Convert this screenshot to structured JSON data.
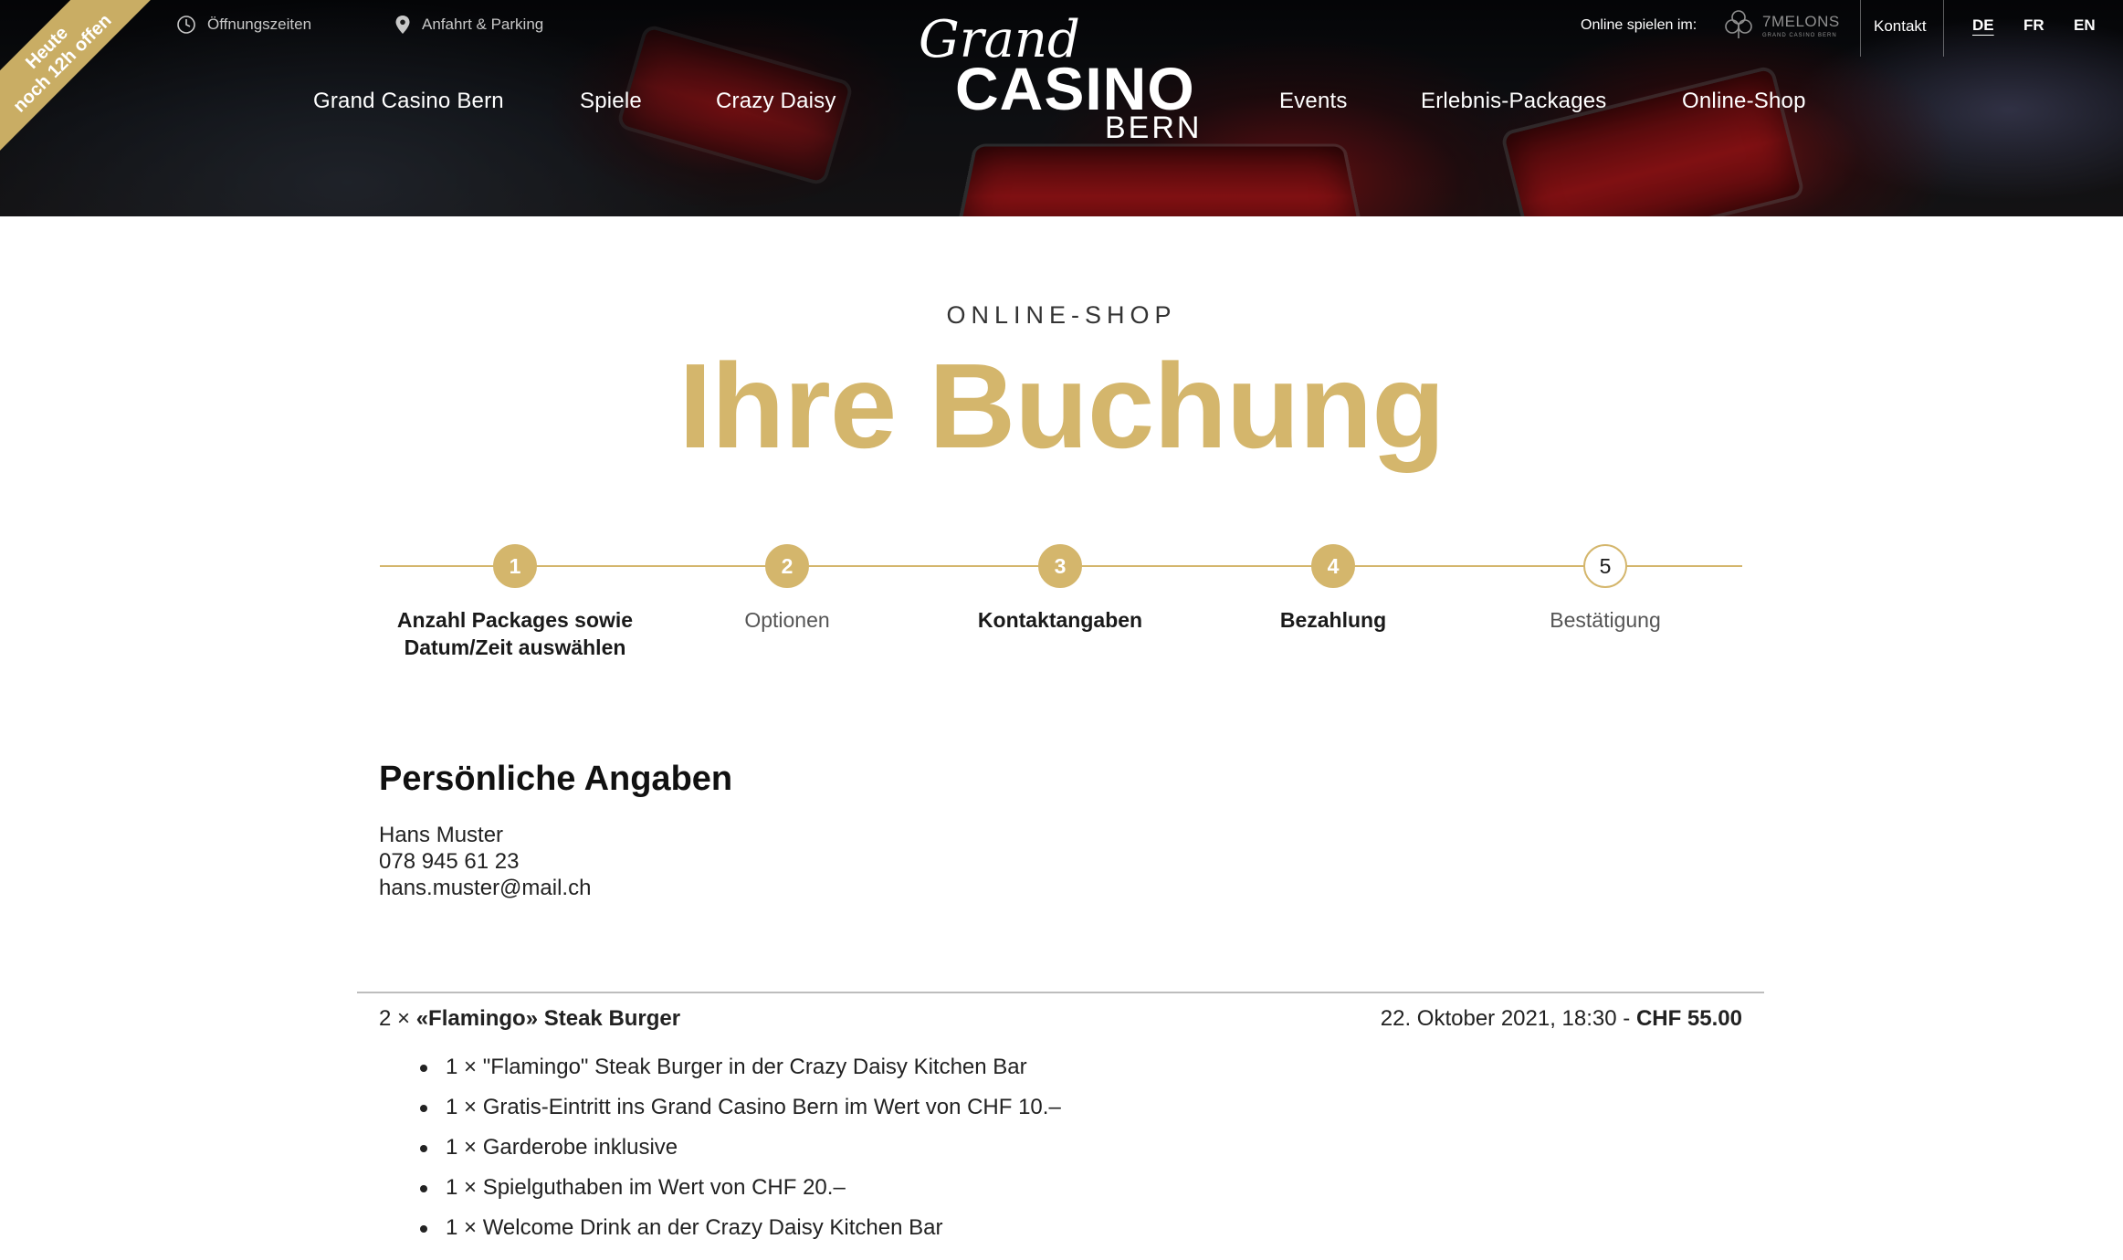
{
  "header": {
    "badge": {
      "line1": "Heute",
      "line2": "noch 12h offen"
    },
    "utility": {
      "hours": {
        "label": "Öffnungszeiten",
        "icon": "clock-icon"
      },
      "directions": {
        "label": "Anfahrt & Parking",
        "icon": "map-pin-icon"
      }
    },
    "nav_left": [
      "Grand Casino Bern",
      "Spiele",
      "Crazy Daisy"
    ],
    "nav_right": [
      "Events",
      "Erlebnis-Packages",
      "Online-Shop"
    ],
    "logo": {
      "grand": "Grand",
      "casino": "CASINO",
      "bern": "BERN"
    },
    "online_play": {
      "label": "Online spielen im:",
      "brand": "7MELONS",
      "brand_sub": "GRAND CASINO BERN"
    },
    "contact": "Kontakt",
    "languages": [
      {
        "code": "DE",
        "active": true
      },
      {
        "code": "FR",
        "active": false
      },
      {
        "code": "EN",
        "active": false
      }
    ],
    "colors": {
      "gold": "#c9ad64"
    }
  },
  "page": {
    "eyebrow": "ONLINE-SHOP",
    "title": "Ihre Buchung",
    "accent_color": "#d4b66c"
  },
  "steps": [
    {
      "number": "1",
      "label_line1": "Anzahl Packages sowie",
      "label_line2": "Datum/Zeit auswählen",
      "state": "done"
    },
    {
      "number": "2",
      "label_line1": "Optionen",
      "label_line2": "",
      "state": "done"
    },
    {
      "number": "3",
      "label_line1": "Kontaktangaben",
      "label_line2": "",
      "state": "done"
    },
    {
      "number": "4",
      "label_line1": "Bezahlung",
      "label_line2": "",
      "state": "done"
    },
    {
      "number": "5",
      "label_line1": "Bestätigung",
      "label_line2": "",
      "state": "current"
    }
  ],
  "personal": {
    "title": "Persönliche Angaben",
    "name": "Hans Muster",
    "phone": "078 945 61 23",
    "email": "hans.muster@mail.ch"
  },
  "order": {
    "quantity": "2 ×",
    "product": "«Flamingo» Steak Burger",
    "date": "22. Oktober 2021, 18:30 -",
    "price": "CHF 55.00",
    "items": [
      "1 × \"Flamingo\" Steak Burger in der Crazy Daisy Kitchen Bar",
      "1 × Gratis-Eintritt ins Grand Casino Bern im Wert von CHF 10.–",
      "1 × Garderobe inklusive",
      "1 × Spielguthaben im Wert von CHF 20.–",
      "1 × Welcome Drink an der Crazy Daisy Kitchen Bar"
    ]
  }
}
